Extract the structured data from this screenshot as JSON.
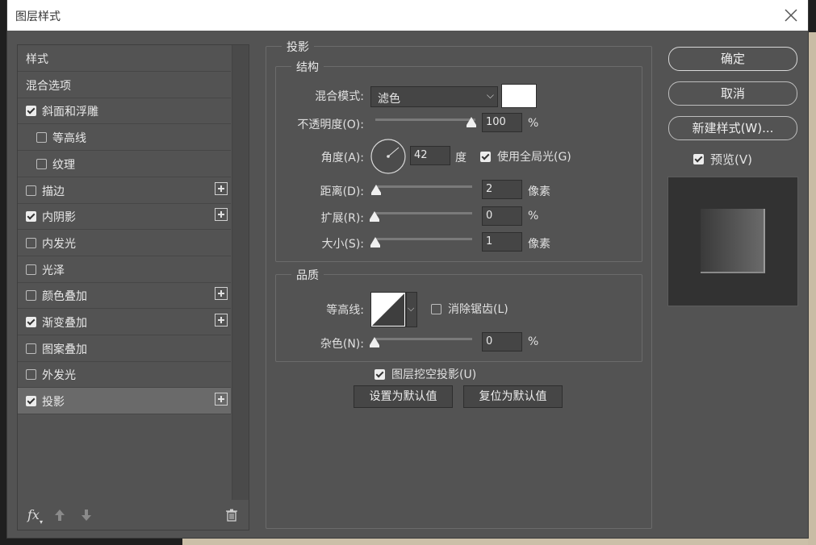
{
  "window": {
    "title": "图层样式"
  },
  "left_list": {
    "items": [
      {
        "label": "样式",
        "checkbox": null,
        "plus": false,
        "indent": false
      },
      {
        "label": "混合选项",
        "checkbox": null,
        "plus": false,
        "indent": false
      },
      {
        "label": "斜面和浮雕",
        "checkbox": true,
        "plus": false,
        "indent": false
      },
      {
        "label": "等高线",
        "checkbox": false,
        "plus": false,
        "indent": true
      },
      {
        "label": "纹理",
        "checkbox": false,
        "plus": false,
        "indent": true
      },
      {
        "label": "描边",
        "checkbox": false,
        "plus": true,
        "indent": false
      },
      {
        "label": "内阴影",
        "checkbox": true,
        "plus": true,
        "indent": false
      },
      {
        "label": "内发光",
        "checkbox": false,
        "plus": false,
        "indent": false
      },
      {
        "label": "光泽",
        "checkbox": false,
        "plus": false,
        "indent": false
      },
      {
        "label": "颜色叠加",
        "checkbox": false,
        "plus": true,
        "indent": false
      },
      {
        "label": "渐变叠加",
        "checkbox": true,
        "plus": true,
        "indent": false
      },
      {
        "label": "图案叠加",
        "checkbox": false,
        "plus": false,
        "indent": false
      },
      {
        "label": "外发光",
        "checkbox": false,
        "plus": false,
        "indent": false
      },
      {
        "label": "投影",
        "checkbox": true,
        "plus": true,
        "indent": false,
        "active": true
      }
    ],
    "footer": {
      "fx_label": "fx"
    }
  },
  "main": {
    "section_title": "投影",
    "structure": {
      "title": "结构",
      "blend_mode_label": "混合模式:",
      "blend_mode_value": "滤色",
      "blend_color": "#ffffff",
      "opacity_label": "不透明度(O):",
      "opacity_value": "100",
      "opacity_unit": "%",
      "angle_label": "角度(A):",
      "angle_value": "42",
      "angle_unit": "度",
      "global_light_label": "使用全局光(G)",
      "global_light_checked": true,
      "distance_label": "距离(D):",
      "distance_value": "2",
      "distance_unit": "像素",
      "spread_label": "扩展(R):",
      "spread_value": "0",
      "spread_unit": "%",
      "size_label": "大小(S):",
      "size_value": "1",
      "size_unit": "像素"
    },
    "quality": {
      "title": "品质",
      "contour_label": "等高线:",
      "antialias_label": "消除锯齿(L)",
      "antialias_checked": false,
      "noise_label": "杂色(N):",
      "noise_value": "0",
      "noise_unit": "%"
    },
    "knockout_label": "图层挖空投影(U)",
    "knockout_checked": true,
    "set_default_label": "设置为默认值",
    "reset_default_label": "复位为默认值"
  },
  "right": {
    "ok_label": "确定",
    "cancel_label": "取消",
    "new_style_label": "新建样式(W)...",
    "preview_label": "预览(V)",
    "preview_checked": true
  }
}
